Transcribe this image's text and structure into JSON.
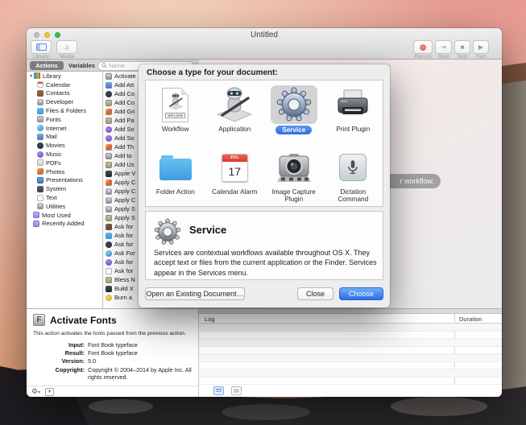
{
  "window": {
    "title": "Untitled"
  },
  "toolbar": {
    "library": "Library",
    "media": "Media",
    "record": "Record",
    "step": "Step",
    "stop": "Stop",
    "run": "Run"
  },
  "tabs": {
    "actions": "Actions",
    "variables": "Variables"
  },
  "search": {
    "placeholder": "Name"
  },
  "sidebar": {
    "items": [
      "Library",
      "Calendar",
      "Contacts",
      "Developer",
      "Files & Folders",
      "Fonts",
      "Internet",
      "Mail",
      "Movies",
      "Music",
      "PDFs",
      "Photos",
      "Presentations",
      "System",
      "Text",
      "Utilities",
      "Most Used",
      "Recently Added"
    ]
  },
  "actions": [
    "Activate",
    "Add Att",
    "Add Co",
    "Add Co",
    "Add Gri",
    "Add Pa",
    "Add So",
    "Add So",
    "Add Th",
    "Add to",
    "Add Us",
    "Apple V",
    "Apply C",
    "Apply C",
    "Apply C",
    "Apply S",
    "Apply S",
    "Ask for",
    "Ask for",
    "Ask for",
    "Ask For",
    "Ask for",
    "Ask for",
    "Bless N",
    "Build X",
    "Burn a"
  ],
  "canvas": {
    "hint_visible": "r workflow."
  },
  "dialog": {
    "title": "Choose a type for your document:",
    "types": [
      {
        "label": "Workflow",
        "badge": "WFLOW"
      },
      {
        "label": "Application"
      },
      {
        "label": "Service",
        "selected": true
      },
      {
        "label": "Print Plugin"
      },
      {
        "label": "Folder Action"
      },
      {
        "label": "Calendar Alarm",
        "month": "JUL",
        "day": "17"
      },
      {
        "label": "Image Capture Plugin"
      },
      {
        "label": "Dictation Command"
      }
    ],
    "description": {
      "title": "Service",
      "body": "Services are contextual workflows available throughout OS X. They accept text or files from the current application or the Finder. Services appear in the Services menu."
    },
    "buttons": {
      "open": "Open an Existing Document…",
      "close": "Close",
      "choose": "Choose"
    }
  },
  "action_info": {
    "title": "Activate Fonts",
    "summary": "This action activates the fonts passed from the previous action.",
    "fields": [
      {
        "label": "Input:",
        "value": "Font Book typeface"
      },
      {
        "label": "Result:",
        "value": "Font Book typeface"
      },
      {
        "label": "Version:",
        "value": "5.0"
      },
      {
        "label": "Copyright:",
        "value": "Copyright © 2004–2014 by Apple Inc. All rights reserved."
      }
    ]
  },
  "log": {
    "columns": [
      "Log",
      "Duration"
    ]
  },
  "colors": {
    "selection_blue": "#2e6ee4",
    "record_red": "#d95850",
    "folder_blue": "#3f9bde"
  }
}
